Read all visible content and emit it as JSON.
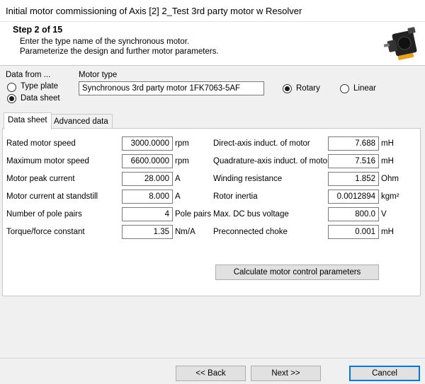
{
  "window": {
    "title": "Initial motor commissioning of Axis [2] 2_Test 3rd party motor w Resolver"
  },
  "header": {
    "step": "Step 2 of 15",
    "line1": "Enter the type name of the synchronous motor.",
    "line2": "Parameterize the design and further motor parameters."
  },
  "data_from": {
    "label": "Data from ...",
    "options": [
      {
        "label": "Type plate",
        "selected": false
      },
      {
        "label": "Data sheet",
        "selected": true
      }
    ]
  },
  "motor_type": {
    "label": "Motor type",
    "value": "Synchronous 3rd party motor 1FK7063-5AF"
  },
  "motion": {
    "options": [
      {
        "label": "Rotary",
        "selected": true
      },
      {
        "label": "Linear",
        "selected": false
      }
    ]
  },
  "tabs": [
    {
      "label": "Data sheet",
      "active": true
    },
    {
      "label": "Advanced data",
      "active": false
    }
  ],
  "left_params": [
    {
      "label": "Rated motor speed",
      "value": "3000.0000",
      "unit": "rpm"
    },
    {
      "label": "Maximum motor speed",
      "value": "6600.0000",
      "unit": "rpm"
    },
    {
      "label": "Motor peak current",
      "value": "28.000",
      "unit": "A"
    },
    {
      "label": "Motor current at standstill",
      "value": "8.000",
      "unit": "A"
    },
    {
      "label": "Number of pole pairs",
      "value": "4",
      "unit": "Pole pairs"
    },
    {
      "label": "Torque/force constant",
      "value": "1.35",
      "unit": "Nm/A"
    }
  ],
  "right_params": [
    {
      "label": "Direct-axis induct. of motor",
      "value": "7.688",
      "unit": "mH"
    },
    {
      "label": "Quadrature-axis induct. of motor",
      "value": "7.516",
      "unit": "mH"
    },
    {
      "label": "Winding resistance",
      "value": "1.852",
      "unit": "Ohm"
    },
    {
      "label": "Rotor inertia",
      "value": "0.0012894",
      "unit": "kgm²"
    },
    {
      "label": "Max. DC bus voltage",
      "value": "800.0",
      "unit": "V"
    },
    {
      "label": "Preconnected choke",
      "value": "0.001",
      "unit": "mH"
    }
  ],
  "calc_button": "Calculate motor control parameters",
  "footer": {
    "back": "<< Back",
    "next": "Next >>",
    "cancel": "Cancel"
  },
  "icons": {
    "motor": "servo-motor-icon"
  }
}
